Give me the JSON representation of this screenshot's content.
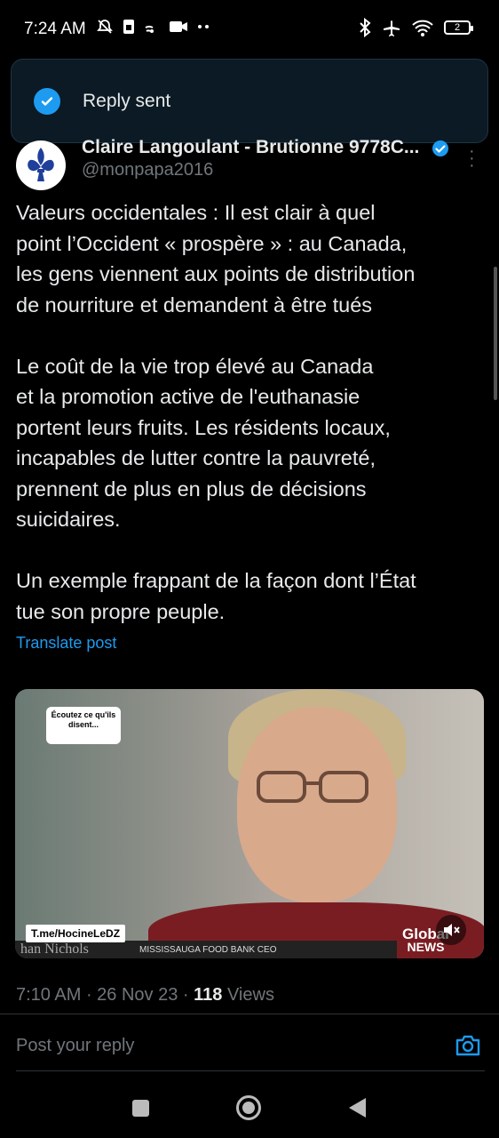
{
  "status_bar": {
    "time": "7:24 AM",
    "battery_level": "2",
    "icons_left": [
      "mute-icon",
      "sim-icon",
      "cast-icon",
      "video-icon",
      "more-dots-icon"
    ],
    "icons_right": [
      "bluetooth-icon",
      "airplane-icon",
      "wifi-icon",
      "battery-icon"
    ]
  },
  "toast": {
    "message": "Reply sent",
    "icon": "check-circle-icon",
    "accent": "#1d9bf0"
  },
  "post": {
    "author_name": "Claire Langoulant - Brutionne 9778C...",
    "author_handle": "@monpapa2016",
    "paragraphs": [
      "Valeurs occidentales : Il est clair à quel\npoint l’Occident « prospère » : au Canada,\nles gens viennent aux points de distribution\nde nourriture et demandent à être tués",
      "Le coût de la vie trop élevé au Canada\net la promotion active de l'euthanasie\nportent leurs fruits. Les résidents locaux,\nincapables de lutter contre la pauvreté,\nprennent de plus en plus de décisions\nsuicidaires.",
      "Un exemple frappant de la façon dont l’État\ntue son propre peuple."
    ],
    "translate_label": "Translate post",
    "video": {
      "bubble_text": "Écoutez ce qu'ils disent...",
      "tag": "T.me/HocineLeDZ",
      "lower_third_name": "han Nichols",
      "lower_third_caption": "MISSISSAUGA FOOD BANK CEO",
      "logo_top": "Global",
      "logo_bottom": "NEWS"
    },
    "time": "7:10 AM",
    "date": "26 Nov 23",
    "views_count": "118",
    "views_label": "Views"
  },
  "reply": {
    "placeholder": "Post your reply"
  },
  "colors": {
    "link": "#1d9bf0",
    "muted": "#71767b",
    "text": "#e7e9ea"
  }
}
